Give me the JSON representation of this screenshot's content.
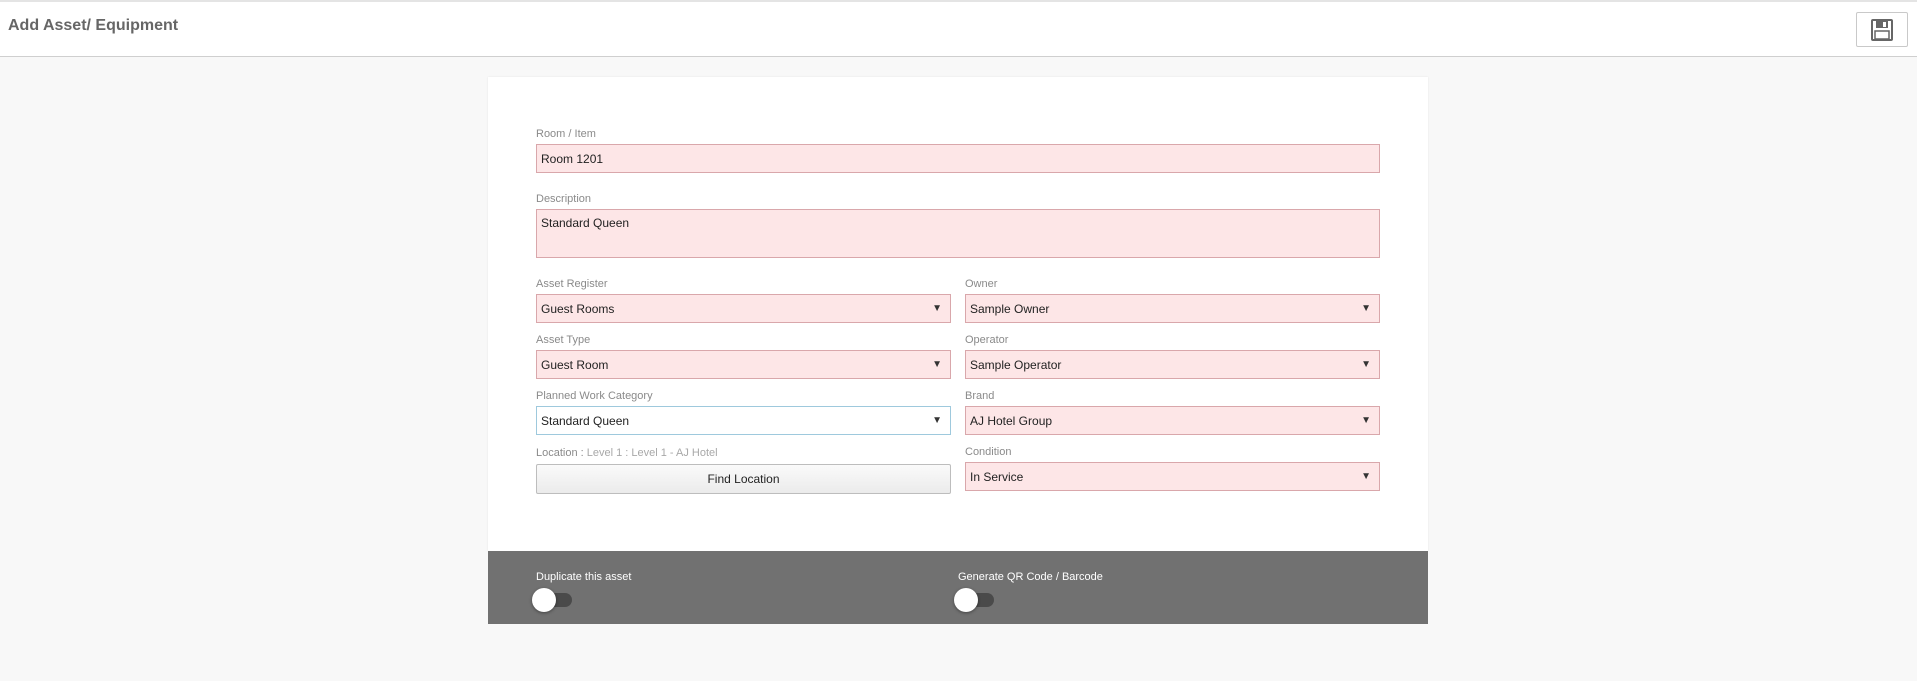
{
  "header": {
    "title": "Add Asset/ Equipment",
    "save_icon": "floppy-disk-icon"
  },
  "form": {
    "room_item": {
      "label": "Room / Item",
      "value": "Room 1201"
    },
    "description": {
      "label": "Description",
      "value": "Standard Queen"
    },
    "asset_register": {
      "label": "Asset Register",
      "value": "Guest Rooms"
    },
    "owner": {
      "label": "Owner",
      "value": "Sample Owner"
    },
    "asset_type": {
      "label": "Asset Type",
      "value": "Guest Room"
    },
    "operator": {
      "label": "Operator",
      "value": "Sample Operator"
    },
    "planned_work_category": {
      "label": "Planned Work Category",
      "value": "Standard Queen"
    },
    "brand": {
      "label": "Brand",
      "value": "AJ Hotel Group"
    },
    "location": {
      "label": "Location :",
      "value": "Level 1 : Level 1 - AJ Hotel",
      "button_label": "Find Location"
    },
    "condition": {
      "label": "Condition",
      "value": "In Service"
    }
  },
  "footer": {
    "duplicate": {
      "label": "Duplicate this asset",
      "on": false
    },
    "generate_code": {
      "label": "Generate QR Code / Barcode",
      "on": false
    }
  },
  "colors": {
    "required_bg": "#fde6e7",
    "required_border": "#d9a7ab",
    "footer_bg": "#717171"
  }
}
